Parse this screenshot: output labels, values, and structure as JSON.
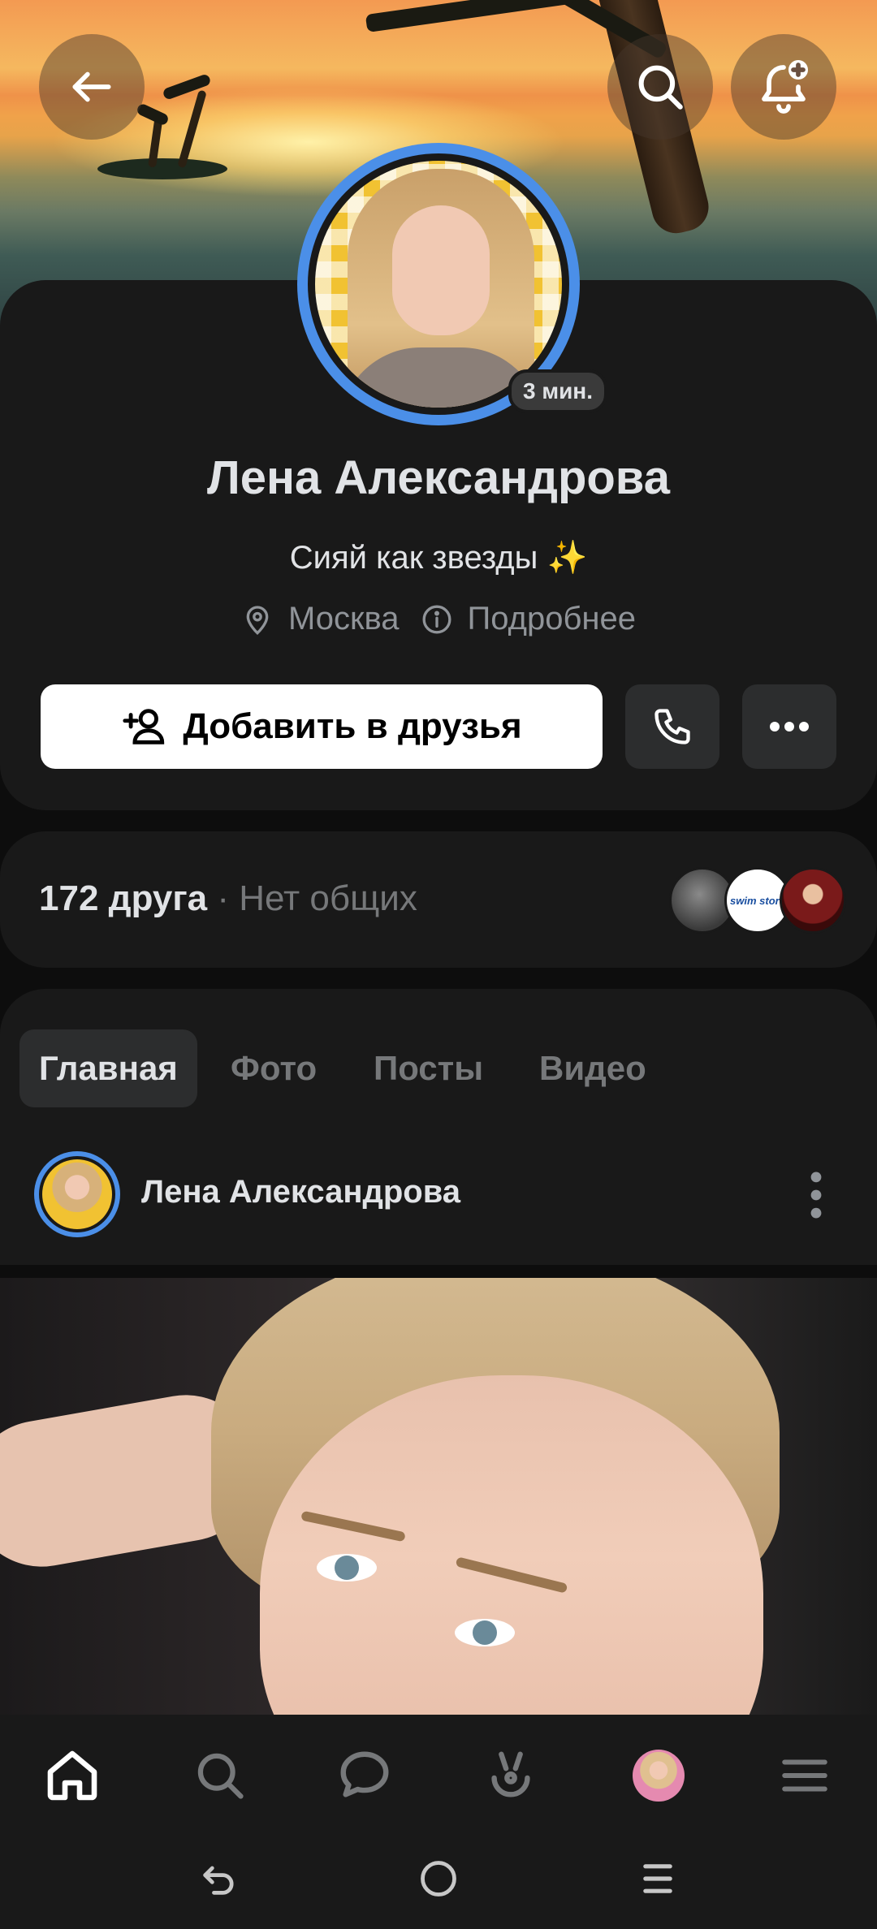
{
  "header": {
    "back_icon": "arrow-left-icon",
    "search_icon": "search-icon",
    "subscribe_icon": "bell-plus-icon"
  },
  "profile": {
    "name": "Лена Александрова",
    "status": "Сияй как звезды ✨",
    "online_badge": "3 мин.",
    "location": "Москва",
    "details_link": "Подробнее",
    "add_friend_label": "Добавить в друзья"
  },
  "friends": {
    "count_label": "172 друга",
    "separator": " · ",
    "common_label": "Нет общих"
  },
  "tabs": [
    {
      "label": "Главная",
      "active": true
    },
    {
      "label": "Фото",
      "active": false
    },
    {
      "label": "Посты",
      "active": false
    },
    {
      "label": "Видео",
      "active": false
    }
  ],
  "post": {
    "author": "Лена Александрова"
  },
  "mini_avatars": [
    {
      "name": "friend-avatar-1"
    },
    {
      "name": "friend-avatar-2",
      "text": "swim store"
    },
    {
      "name": "friend-avatar-3"
    }
  ],
  "bottom_nav": [
    "home-icon",
    "search-icon",
    "messages-icon",
    "clips-icon",
    "profile-avatar",
    "menu-icon"
  ],
  "colors": {
    "accent": "#4b8fe8",
    "card_bg": "#191919",
    "text_primary": "#e1e3e6",
    "text_secondary": "#76787a"
  }
}
